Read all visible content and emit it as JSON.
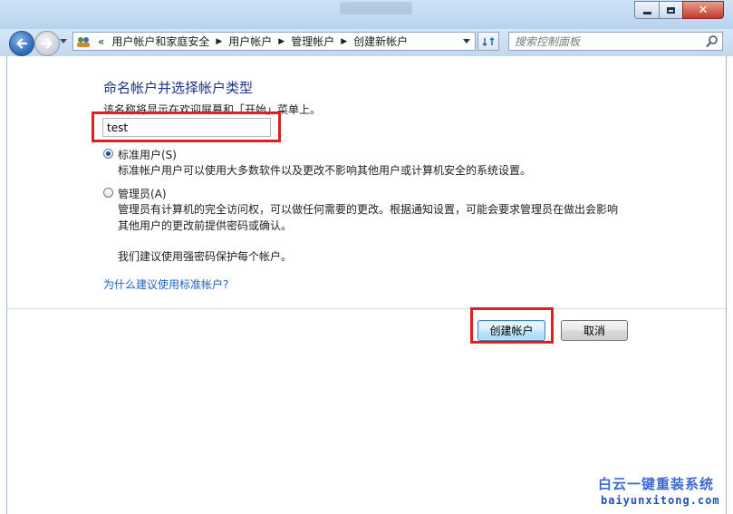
{
  "window": {
    "close_glyph": "✕"
  },
  "nav": {
    "breadcrumb_prefix": "«",
    "breadcrumbs": [
      "用户帐户和家庭安全",
      "用户帐户",
      "管理帐户",
      "创建新帐户"
    ],
    "search_placeholder": "搜索控制面板"
  },
  "page": {
    "heading": "命名帐户并选择帐户类型",
    "subtext": "该名称将显示在欢迎屏幕和「开始」菜单上。",
    "account_name_value": "test",
    "options": [
      {
        "label": "标准用户(S)",
        "selected": true,
        "description": "标准帐户用户可以使用大多数软件以及更改不影响其他用户或计算机安全的系统设置。"
      },
      {
        "label": "管理员(A)",
        "selected": false,
        "description_line1": "管理员有计算机的完全访问权，可以做任何需要的更改。根据通知设置，可能会要求管理员在做出会影响",
        "description_line2": "其他用户的更改前提供密码或确认。"
      }
    ],
    "advice": "我们建议使用强密码保护每个帐户。",
    "help_link": "为什么建议使用标准帐户?"
  },
  "buttons": {
    "create": "创建帐户",
    "cancel": "取消"
  },
  "watermark": {
    "chinese": "白云一键重装系统",
    "url": "baiyunxitong.com"
  },
  "colors": {
    "heading": "#1e3287",
    "link": "#1b64c4",
    "highlight_box": "#e02020"
  },
  "icons": [
    "back-arrow-icon",
    "forward-arrow-icon",
    "control-panel-icon",
    "refresh-icon",
    "search-icon"
  ]
}
